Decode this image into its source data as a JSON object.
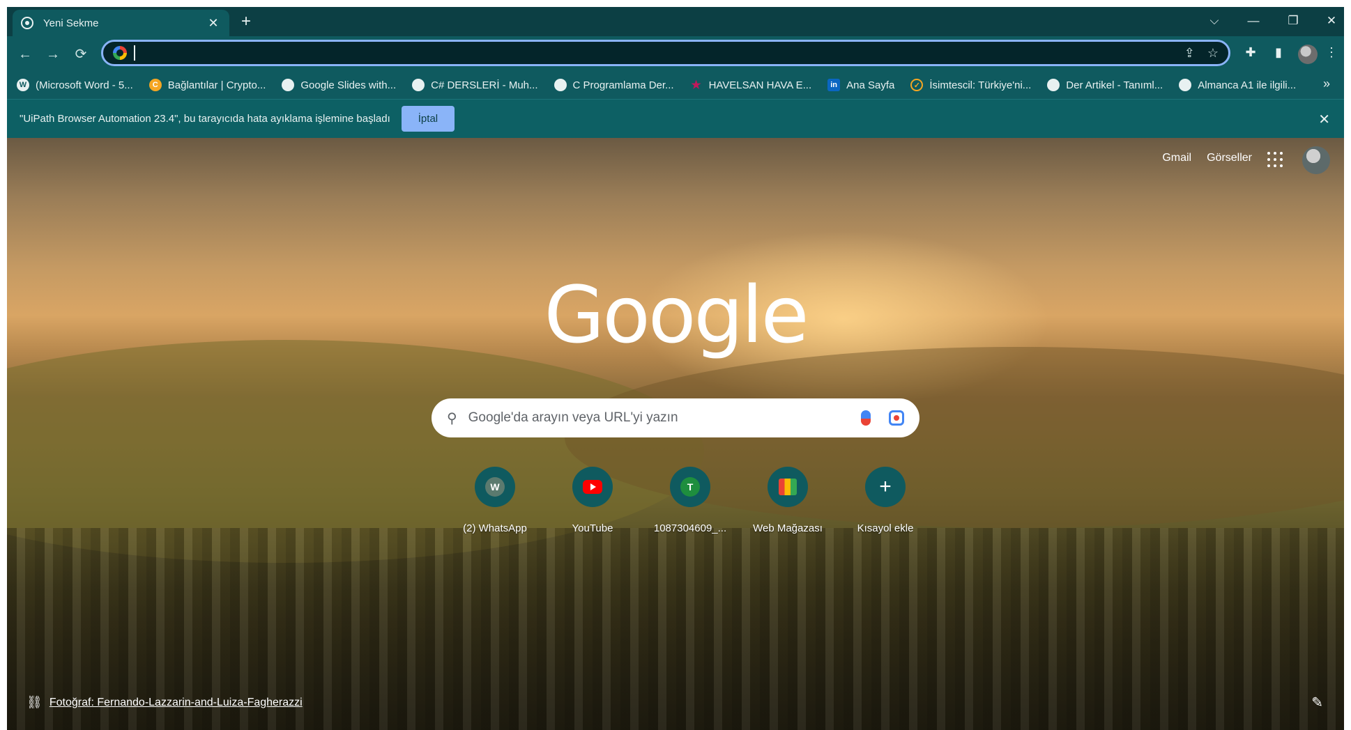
{
  "tab": {
    "title": "Yeni Sekme",
    "close": "✕",
    "new_tab": "+"
  },
  "window_controls": {
    "tab_search": "⌵",
    "minimize": "—",
    "restore": "❐",
    "close": "✕"
  },
  "toolbar": {
    "back": "←",
    "forward": "→",
    "reload": "⟳",
    "share_icon": "⇪",
    "star_icon": "☆",
    "extensions_icon": "✚",
    "sidepanel_icon": "▮",
    "menu_icon": "⋮"
  },
  "omnibox": {
    "value": ""
  },
  "bookmarks": [
    {
      "label": "(Microsoft Word - 5...",
      "icon": "W"
    },
    {
      "label": "Bağlantılar | Crypto...",
      "icon": "C"
    },
    {
      "label": "Google Slides with...",
      "icon": ""
    },
    {
      "label": "C# DERSLERİ - Muh...",
      "icon": ""
    },
    {
      "label": "C Programlama Der...",
      "icon": ""
    },
    {
      "label": "HAVELSAN HAVA E...",
      "icon": "★"
    },
    {
      "label": "Ana Sayfa",
      "icon": "in"
    },
    {
      "label": "İsimtescil: Türkiye'ni...",
      "icon": "✓"
    },
    {
      "label": "Der Artikel - Tanıml...",
      "icon": ""
    },
    {
      "label": "Almanca A1 ile ilgili...",
      "icon": ""
    }
  ],
  "bookmarks_more": "»",
  "infobar": {
    "message": "\"UiPath Browser Automation 23.4\", bu tarayıcıda hata ayıklama işlemine başladı",
    "cancel_label": "İptal",
    "close": "✕"
  },
  "page": {
    "top_links": {
      "gmail": "Gmail",
      "images": "Görseller"
    },
    "logo": "Google",
    "search_placeholder": "Google'da arayın veya URL'yi yazın",
    "shortcuts": [
      {
        "label": "(2) WhatsApp",
        "letter": "W",
        "color": "#5b7a6f"
      },
      {
        "label": "YouTube",
        "letter": "",
        "color": "#ff0000"
      },
      {
        "label": "1087304609_...",
        "letter": "T",
        "color": "#1e8e3e"
      },
      {
        "label": "Web Mağazası",
        "letter": "",
        "color": "#ffffff"
      },
      {
        "label": "Kısayol ekle",
        "letter": "+",
        "color": "#0f5a5f"
      }
    ],
    "photo_credit": "Fotoğraf: Fernando-Lazzarin-and-Luiza-Fagherazzi"
  },
  "colors": {
    "theme_dark": "#0c3f44",
    "theme": "#0f5a5f",
    "accent": "#8ab4f8"
  }
}
